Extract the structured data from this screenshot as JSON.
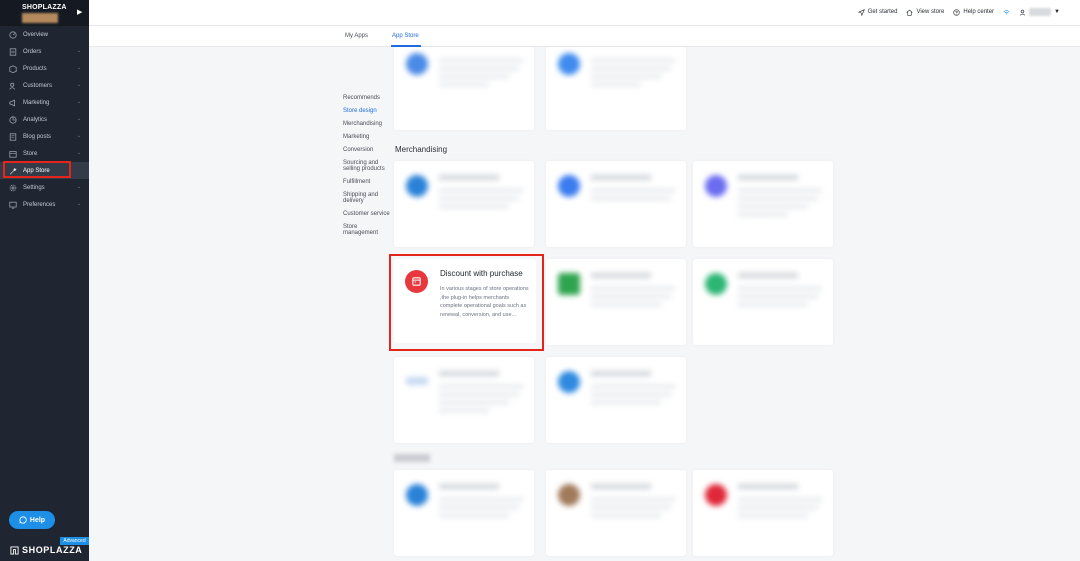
{
  "sidebar": {
    "store_name": "SHOPLAZZA",
    "items": [
      {
        "label": "Overview",
        "icon": "overview-icon",
        "expandable": false
      },
      {
        "label": "Orders",
        "icon": "orders-icon",
        "expandable": true
      },
      {
        "label": "Products",
        "icon": "products-icon",
        "expandable": true
      },
      {
        "label": "Customers",
        "icon": "customers-icon",
        "expandable": true
      },
      {
        "label": "Marketing",
        "icon": "marketing-icon",
        "expandable": true
      },
      {
        "label": "Analytics",
        "icon": "analytics-icon",
        "expandable": true
      },
      {
        "label": "Blog posts",
        "icon": "blog-icon",
        "expandable": true
      },
      {
        "label": "Store",
        "icon": "store-icon",
        "expandable": true
      },
      {
        "label": "App Store",
        "icon": "wrench-icon",
        "expandable": false,
        "active": true
      },
      {
        "label": "Settings",
        "icon": "gear-icon",
        "expandable": true
      },
      {
        "label": "Preferences",
        "icon": "preferences-icon",
        "expandable": true
      }
    ],
    "help_label": "Help",
    "plan_badge": "Advanced",
    "footer_logo": "SHOPLAZZA"
  },
  "topbar": {
    "get_started": "Get started",
    "view_store": "View store",
    "help_center": "Help center"
  },
  "tabs": [
    {
      "label": "My Apps"
    },
    {
      "label": "App Store",
      "active": true
    }
  ],
  "categories": [
    "Recommends",
    "Store design",
    "Merchandising",
    "Marketing",
    "Conversion",
    "Sourcing and selling products",
    "Fulfillment",
    "Shipping and delivery",
    "Customer service",
    "Store management"
  ],
  "active_category": "Store design",
  "section": {
    "merchandising_title": "Merchandising"
  },
  "featured_app": {
    "title": "Discount with purchase",
    "description": "In various stages of store operations ,the plug-in helps merchants complete operational goals such as renewal, conversion, and use..."
  },
  "colors": {
    "accent": "#1f6de0",
    "sidebar_bg": "#1f2632",
    "highlight": "#e5251c",
    "app_icon": "#e8383d",
    "help_button": "#1d8fe6"
  }
}
